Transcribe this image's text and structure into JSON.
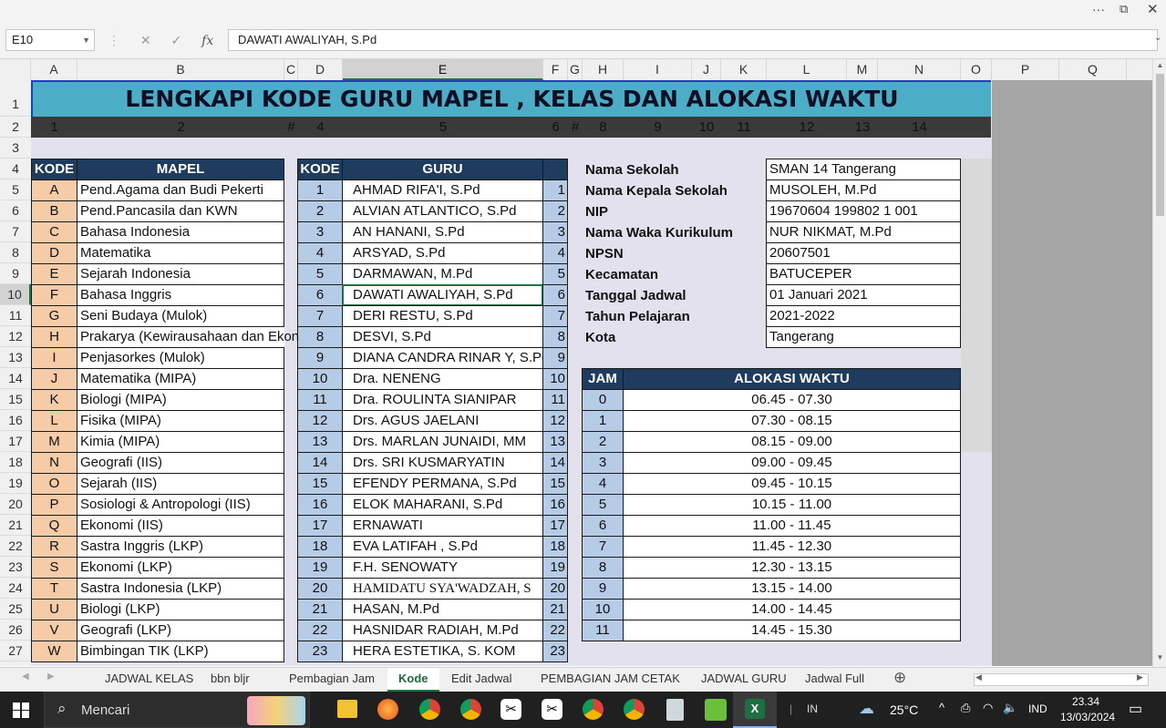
{
  "formula_bar": {
    "name_box": "E10",
    "fx": "fx",
    "content": "DAWATI AWALIYAH, S.Pd"
  },
  "columns": [
    "A",
    "B",
    "C",
    "D",
    "E",
    "F",
    "G",
    "H",
    "I",
    "J",
    "K",
    "L",
    "M",
    "N",
    "O",
    "P",
    "Q"
  ],
  "rows": [
    "1",
    "2",
    "3",
    "4",
    "5",
    "6",
    "7",
    "8",
    "9",
    "10",
    "11",
    "12",
    "13",
    "14",
    "15",
    "16",
    "17",
    "18",
    "19",
    "20",
    "21",
    "22",
    "23",
    "24",
    "25",
    "26",
    "27"
  ],
  "title": "LENGKAPI KODE GURU MAPEL , KELAS DAN ALOKASI WAKTU",
  "number_row": [
    "1",
    "2",
    "#",
    "4",
    "5",
    "6",
    "#",
    "8",
    "9",
    "10",
    "11",
    "12",
    "13",
    "14"
  ],
  "mapel_table": {
    "headers": [
      "KODE",
      "MAPEL"
    ],
    "rows": [
      [
        "A",
        "Pend.Agama dan Budi Pekerti"
      ],
      [
        "B",
        "Pend.Pancasila dan KWN"
      ],
      [
        "C",
        "Bahasa Indonesia"
      ],
      [
        "D",
        "Matematika"
      ],
      [
        "E",
        "Sejarah Indonesia"
      ],
      [
        "F",
        "Bahasa Inggris"
      ],
      [
        "G",
        "Seni Budaya (Mulok)"
      ],
      [
        "H",
        "Prakarya (Kewirausahaan dan Ekon"
      ],
      [
        "I",
        "Penjasorkes (Mulok)"
      ],
      [
        "J",
        "Matematika (MIPA)"
      ],
      [
        "K",
        "Biologi (MIPA)"
      ],
      [
        "L",
        "Fisika (MIPA)"
      ],
      [
        "M",
        "Kimia (MIPA)"
      ],
      [
        "N",
        "Geografi (IIS)"
      ],
      [
        "O",
        "Sejarah (IIS)"
      ],
      [
        "P",
        "Sosiologi & Antropologi (IIS)"
      ],
      [
        "Q",
        "Ekonomi (IIS)"
      ],
      [
        "R",
        "Sastra Inggris (LKP)"
      ],
      [
        "S",
        "Ekonomi (LKP)"
      ],
      [
        "T",
        "Sastra Indonesia (LKP)"
      ],
      [
        "U",
        "Biologi (LKP)"
      ],
      [
        "V",
        "Geografi (LKP)"
      ],
      [
        "W",
        "Bimbingan TIK (LKP)"
      ]
    ]
  },
  "guru_table": {
    "headers": [
      "KODE",
      "GURU",
      ""
    ],
    "rows": [
      [
        "1",
        "AHMAD RIFA'I, S.Pd",
        "1"
      ],
      [
        "2",
        "ALVIAN ATLANTICO, S.Pd",
        "2"
      ],
      [
        "3",
        "AN HANANI, S.Pd",
        "3"
      ],
      [
        "4",
        "ARSYAD, S.Pd",
        "4"
      ],
      [
        "5",
        "DARMAWAN, M.Pd",
        "5"
      ],
      [
        "6",
        "DAWATI AWALIYAH, S.Pd",
        "6"
      ],
      [
        "7",
        "DERI RESTU, S.Pd",
        "7"
      ],
      [
        "8",
        "DESVI, S.Pd",
        "8"
      ],
      [
        "9",
        "DIANA CANDRA RINAR Y, S.Pd",
        "9"
      ],
      [
        "10",
        "Dra. NENENG",
        "10"
      ],
      [
        "11",
        "Dra. ROULINTA SIANIPAR",
        "11"
      ],
      [
        "12",
        "Drs. AGUS JAELANI",
        "12"
      ],
      [
        "13",
        "Drs. MARLAN JUNAIDI, MM",
        "13"
      ],
      [
        "14",
        "Drs. SRI KUSMARYATIN",
        "14"
      ],
      [
        "15",
        "EFENDY PERMANA, S.Pd",
        "15"
      ],
      [
        "16",
        "ELOK MAHARANI, S.Pd",
        "16"
      ],
      [
        "17",
        "ERNAWATI",
        "17"
      ],
      [
        "18",
        "EVA LATIFAH , S.Pd",
        "18"
      ],
      [
        "19",
        "F.H. SENOWATY",
        "19"
      ],
      [
        "20",
        "HAMIDATU SYA'WADZAH, S",
        "20"
      ],
      [
        "21",
        "HASAN, M.Pd",
        "21"
      ],
      [
        "22",
        "HASNIDAR RADIAH, M.Pd",
        "22"
      ],
      [
        "23",
        "HERA ESTETIKA, S. KOM",
        "23"
      ]
    ]
  },
  "school_info": [
    [
      "Nama Sekolah",
      "SMAN 14 Tangerang"
    ],
    [
      "Nama Kepala Sekolah",
      "MUSOLEH, M.Pd"
    ],
    [
      "NIP",
      "19670604 199802 1 001"
    ],
    [
      "Nama Waka Kurikulum",
      "NUR NIKMAT, M.Pd"
    ],
    [
      "NPSN",
      "20607501"
    ],
    [
      "Kecamatan",
      "BATUCEPER"
    ],
    [
      "Tanggal Jadwal",
      "01 Januari 2021"
    ],
    [
      "Tahun Pelajaran",
      "2021-2022"
    ],
    [
      "Kota",
      "Tangerang"
    ]
  ],
  "alokasi_table": {
    "headers": [
      "JAM",
      "ALOKASI WAKTU"
    ],
    "rows": [
      [
        "0",
        "06.45 - 07.30"
      ],
      [
        "1",
        "07.30 - 08.15"
      ],
      [
        "2",
        "08.15 - 09.00"
      ],
      [
        "3",
        "09.00 - 09.45"
      ],
      [
        "4",
        "09.45 - 10.15"
      ],
      [
        "5",
        "10.15 - 11.00"
      ],
      [
        "6",
        "11.00 - 11.45"
      ],
      [
        "7",
        "11.45 - 12.30"
      ],
      [
        "8",
        "12.30 - 13.15"
      ],
      [
        "9",
        "13.15 - 14.00"
      ],
      [
        "10",
        "14.00 - 14.45"
      ],
      [
        "11",
        "14.45 - 15.30"
      ]
    ]
  },
  "sheet_tabs": [
    "JADWAL KELAS",
    "bbn bljr",
    "Pembagian Jam",
    "Kode",
    "Edit Jadwal",
    "PEMBAGIAN JAM CETAK",
    "JADWAL GURU",
    "Jadwal Full"
  ],
  "active_tab": "Kode",
  "taskbar": {
    "search": "Mencari",
    "lang": "IN",
    "temp": "25°C",
    "kbd": "IND",
    "time": "23.34",
    "date": "13/03/2024"
  },
  "colors": {
    "accent": "#217346",
    "title_bg": "#4badc6",
    "header_bg": "#1f3b5e",
    "kode_bg": "#f6cba8",
    "num_bg": "#b6cbe5",
    "sheet_bg": "#e4e1ee"
  }
}
